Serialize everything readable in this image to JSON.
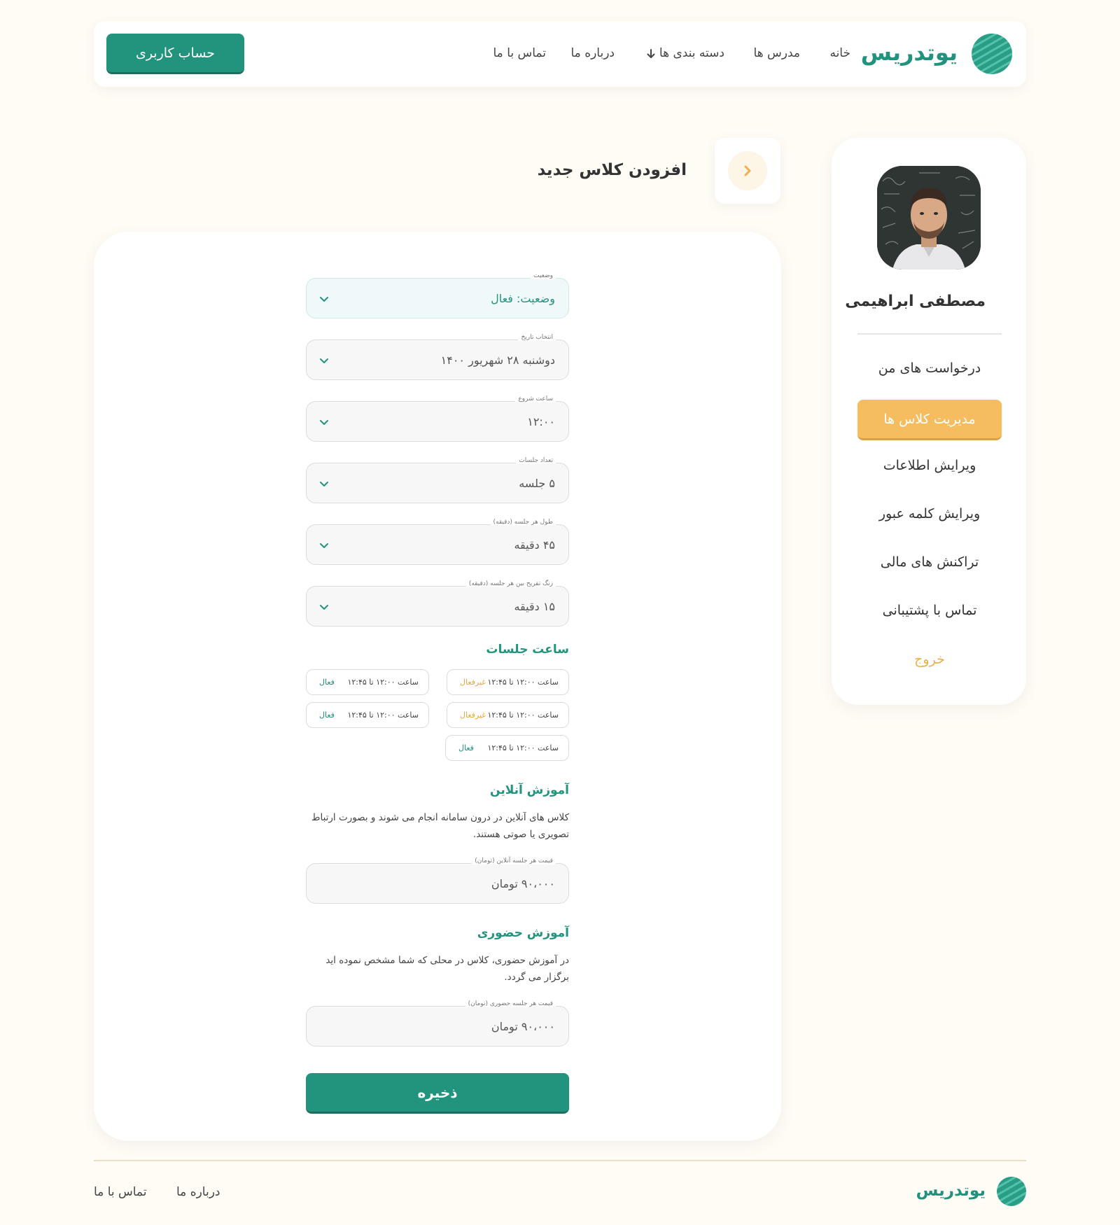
{
  "header": {
    "logo_text": "یوتدریس",
    "nav": {
      "home": "خانه",
      "teachers": "مدرس ها",
      "categories": "دسته بندی ها",
      "about": "درباره ما",
      "contact": "تماس با ما"
    },
    "account_button": "حساب کاربری"
  },
  "sidebar": {
    "user_name": "مصطفی ابراهیمی",
    "items": [
      {
        "label": "درخواست های من",
        "active": false
      },
      {
        "label": "مدیریت کلاس ها",
        "active": true
      },
      {
        "label": "ویرایش اطلاعات",
        "active": false
      },
      {
        "label": "ویرایش کلمه عبور",
        "active": false
      },
      {
        "label": "تراکنش های مالی",
        "active": false
      },
      {
        "label": "تماس با پشتیبانی",
        "active": false
      }
    ],
    "logout": "خروج"
  },
  "page": {
    "title": "افزودن کلاس جدید"
  },
  "form": {
    "status": {
      "label": "وضعیت",
      "value": "وضعیت: فعال"
    },
    "date": {
      "label": "انتخاب تاریخ",
      "value": "دوشنبه ۲۸ شهریور ۱۴۰۰"
    },
    "start_time": {
      "label": "ساعت شروع",
      "value": "۱۲:۰۰"
    },
    "session_count": {
      "label": "تعداد جلسات",
      "value": "۵ جلسه"
    },
    "session_length": {
      "label": "طول هر جلسه (دقیقه)",
      "value": "۴۵ دقیقه"
    },
    "break_length": {
      "label": "زنگ تفریح بین هر جلسه (دقیقه)",
      "value": "۱۵ دقیقه"
    },
    "sessions_title": "ساعت جلسات",
    "sessions": [
      {
        "time": "ساعت ۱۲:۰۰ تا ۱۲:۴۵",
        "status": "غیرفعال"
      },
      {
        "time": "ساعت ۱۲:۰۰ تا ۱۲:۴۵",
        "status": "فعال"
      },
      {
        "time": "ساعت ۱۲:۰۰ تا ۱۲:۴۵",
        "status": "غیرفعال"
      },
      {
        "time": "ساعت ۱۲:۰۰ تا ۱۲:۴۵",
        "status": "فعال"
      },
      {
        "time": "ساعت ۱۲:۰۰ تا ۱۲:۴۵",
        "status": "فعال"
      }
    ],
    "online": {
      "title": "آموزش آنلاین",
      "description": "کلاس های آنلاین در درون سامانه انجام می شوند و بصورت ارتباط تصویری یا صوتی هستند.",
      "price_label": "قیمت هر جلسه آنلاین (تومان)",
      "price_value": "۹۰،۰۰۰  تومان"
    },
    "in_person": {
      "title": "آموزش حضوری",
      "description": "در آموزش حضوری، کلاس در محلی که شما مشخص نموده اید برگزار می گردد.",
      "price_label": "قیمت هر جلسه حضوری (تومان)",
      "price_value": "۹۰،۰۰۰  تومان"
    },
    "save_button": "ذخیره"
  },
  "footer": {
    "logo_text": "یوتدریس",
    "about": "درباره ما",
    "contact": "تماس با ما"
  },
  "colors": {
    "primary": "#22937d",
    "accent": "#f5bd5f",
    "background": "#fffcf6"
  }
}
